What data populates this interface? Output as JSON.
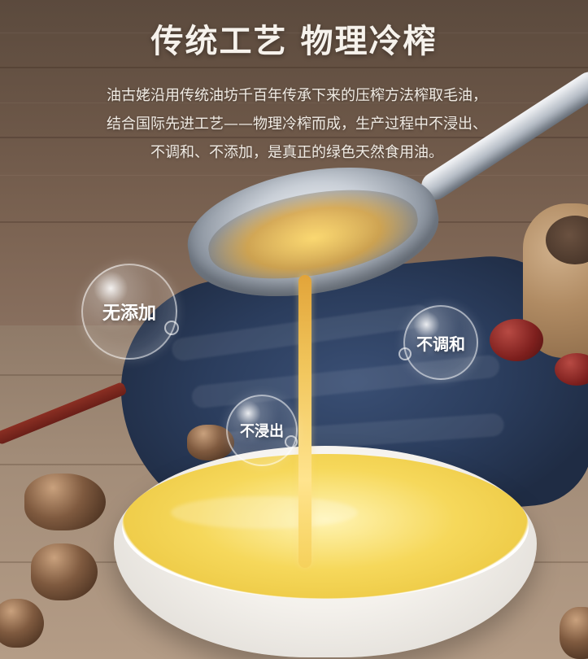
{
  "header": {
    "title": "传统工艺 物理冷榨"
  },
  "description": {
    "lines": [
      "油古姥沿用传统油坊千百年传承下来的压榨方法榨取毛油，",
      "结合国际先进工艺——物理冷榨而成，生产过程中不浸出、",
      "不调和、不添加，是真正的绿色天然食用油。"
    ]
  },
  "badges": {
    "no_additive": "无添加",
    "no_blend": "不调和",
    "no_extraction": "不浸出"
  }
}
